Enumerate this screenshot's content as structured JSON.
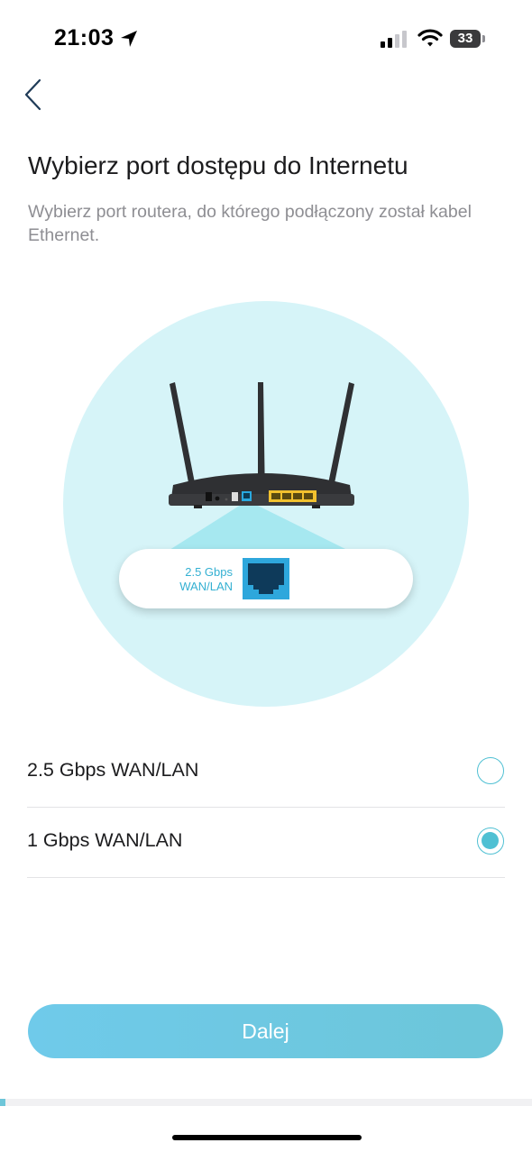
{
  "status_bar": {
    "time": "21:03",
    "battery": "33",
    "icons": [
      "location-arrow-icon",
      "signal-bars-icon",
      "wifi-icon",
      "battery-icon"
    ]
  },
  "nav": {
    "back_icon": "chevron-left-icon"
  },
  "header": {
    "title": "Wybierz port dostępu do Internetu",
    "subtitle": "Wybierz port routera, do którego podłączony został kabel Ethernet."
  },
  "illustration": {
    "port_speed": "2.5 Gbps",
    "port_type": "WAN/LAN",
    "port_icon": "ethernet-port-icon"
  },
  "options": [
    {
      "label": "2.5 Gbps WAN/LAN",
      "selected": false
    },
    {
      "label": "1 Gbps WAN/LAN",
      "selected": true
    }
  ],
  "footer": {
    "next_label": "Dalej"
  },
  "colors": {
    "accent": "#4fc0d3",
    "button": "#6cc6d9",
    "illustration_bg": "#d6f4f8",
    "port_blue": "#2ea7dc",
    "lan_yellow": "#f2c12e"
  }
}
